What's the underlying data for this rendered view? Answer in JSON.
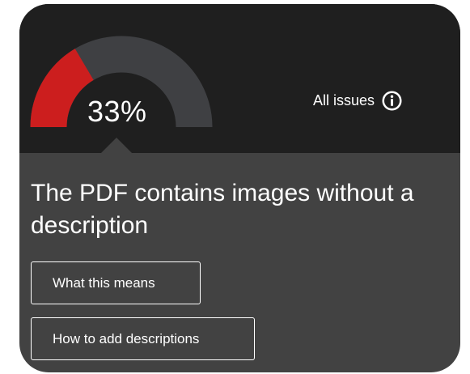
{
  "score": {
    "percent_label": "33%",
    "fraction": 0.33,
    "fill_color": "#cc1e1e",
    "track_color": "#3f4043"
  },
  "header": {
    "all_issues_label": "All issues",
    "info_icon": "info-icon"
  },
  "issue": {
    "title": "The PDF contains images without a description"
  },
  "actions": {
    "means_label": "What this means",
    "howto_label": "How to add descriptions"
  },
  "colors": {
    "card_top": "#1f1f1f",
    "card_body": "#424242",
    "text": "#ffffff"
  }
}
